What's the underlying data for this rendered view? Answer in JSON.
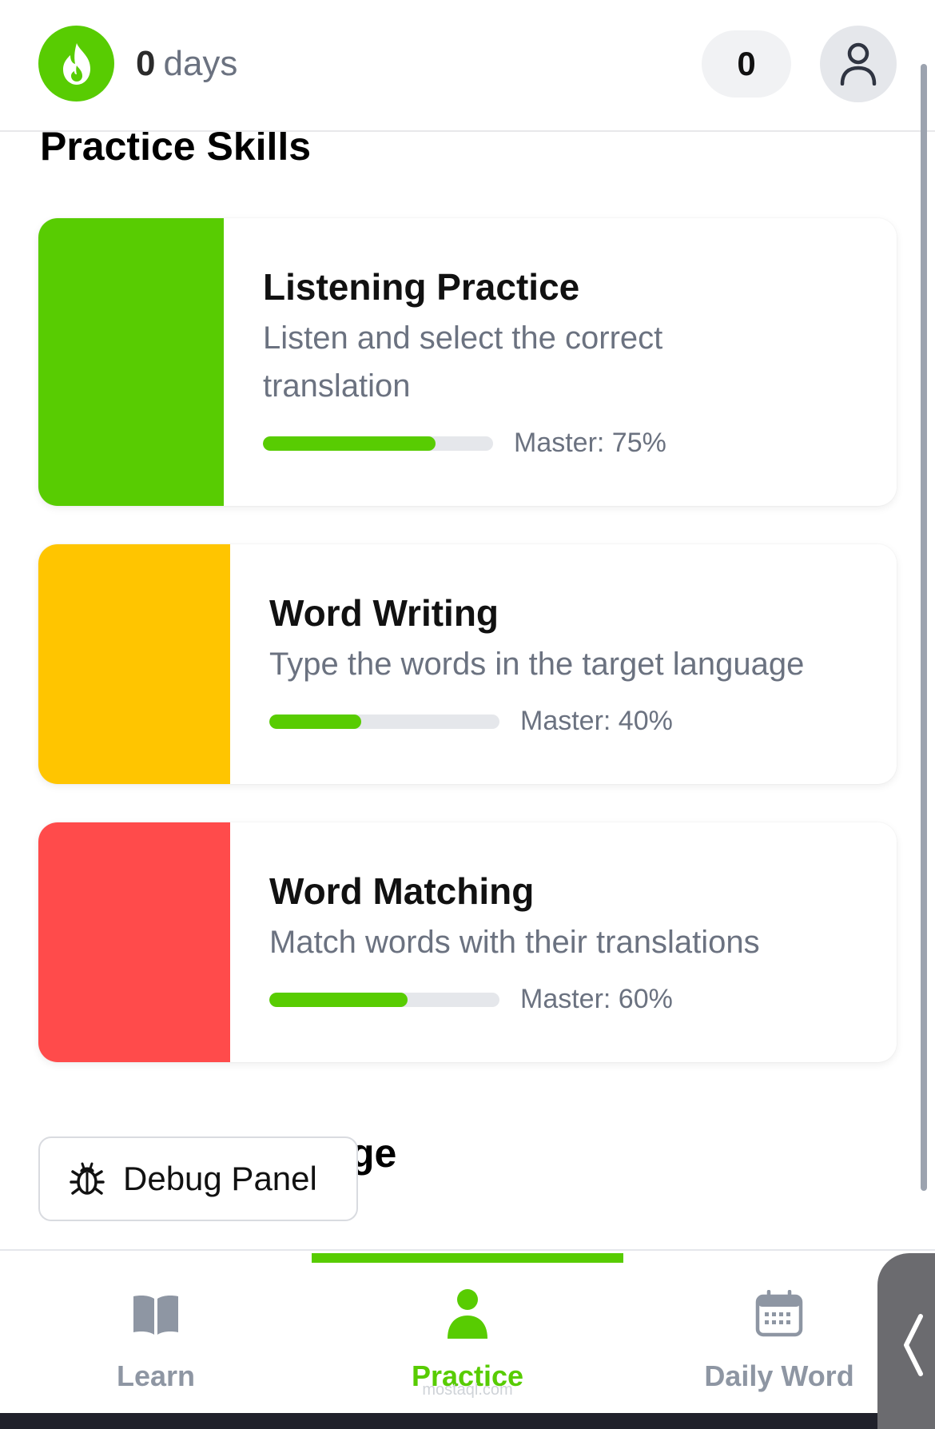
{
  "header": {
    "streak_count": "0",
    "streak_unit": "days",
    "points": "0",
    "icons": {
      "streak": "fire-icon",
      "profile": "user-icon"
    }
  },
  "practice": {
    "section_title": "Practice Skills",
    "skills": [
      {
        "title": "Listening Practice",
        "description": "Listen and select the correct translation",
        "mastery_label": "Master: 75%",
        "mastery": 0.75,
        "color": "#58cc02"
      },
      {
        "title": "Word Writing",
        "description": "Type the words in the target language",
        "mastery_label": "Master: 40%",
        "mastery": 0.4,
        "color": "#ffc500"
      },
      {
        "title": "Word Matching",
        "description": "Match words with their translations",
        "mastery_label": "Master: 60%",
        "mastery": 0.6,
        "color": "#ff4b4b"
      }
    ],
    "next_section_title_visible": "ge"
  },
  "debug": {
    "label": "Debug Panel",
    "icon": "bug-icon"
  },
  "nav": {
    "items": [
      {
        "label": "Learn",
        "icon": "book-icon",
        "active": false
      },
      {
        "label": "Practice",
        "icon": "person-icon",
        "active": true
      },
      {
        "label": "Daily Word",
        "icon": "calendar-icon",
        "active": false
      }
    ]
  },
  "watermark": "mostaql.com",
  "colors": {
    "accent": "#58cc02",
    "muted_text": "#6b7280",
    "inactive_nav": "#8e96a3"
  }
}
